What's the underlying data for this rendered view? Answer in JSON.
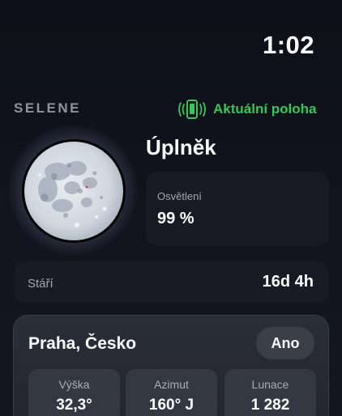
{
  "status_bar": {
    "time": "1:02"
  },
  "header": {
    "app_name": "SELENE",
    "location_status": {
      "label": "Aktuální poloha",
      "icon": "phone-vibrate-icon",
      "color": "#35c759"
    }
  },
  "moon": {
    "image": "full-moon-image",
    "phase_name": "Úplněk",
    "illumination": {
      "label": "Osvětlení",
      "value": "99 %",
      "fraction": 0.99
    }
  },
  "age": {
    "label": "Stáří",
    "value": "16d 4h"
  },
  "location_card": {
    "city": "Praha, Česko",
    "toggle_label": "Ano",
    "stats": [
      {
        "label": "Výška",
        "value": "32,3°"
      },
      {
        "label": "Azimut",
        "value": "160° J"
      },
      {
        "label": "Lunace",
        "value": "1 282"
      }
    ]
  }
}
